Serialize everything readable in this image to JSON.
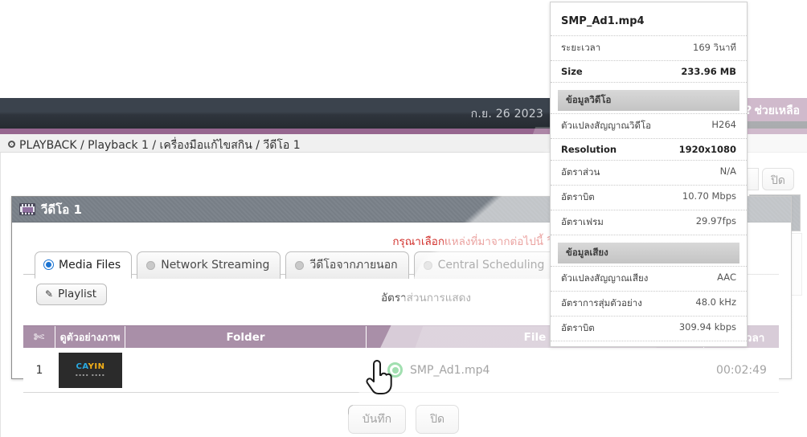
{
  "topbar": {
    "date": "ก.ย. 26 2023",
    "help_q": "?",
    "help_label": "ช่วยเหลือ"
  },
  "breadcrumb": {
    "text": "PLAYBACK / Playback 1 / เครื่องมือแก้ไขสกิน / วีดีโอ 1"
  },
  "right_tools": {
    "close_label": "ปิด",
    "expand_icon": "fullscreen-icon",
    "sound_icon": "speaker-icon"
  },
  "dialog": {
    "title": "วีดีโอ 1",
    "title_icon": "film-icon",
    "error_message": "กรุณาเลือกแหล่งที่มาจากต่อไปนี้ วีดีโอ",
    "tabs": [
      {
        "label": "Media Files",
        "selected": true
      },
      {
        "label": "Network Streaming",
        "selected": false
      },
      {
        "label": "วีดีโอจากภายนอก",
        "selected": false
      },
      {
        "label": "Central Scheduling",
        "selected": false
      }
    ],
    "playlist_button": "Playlist",
    "playlist_icon": "pencil-icon",
    "ratio_label": "อัตราส่วนการแสดง",
    "table": {
      "columns": [
        "✂",
        "ดูตัวอย่างภาพ",
        "Folder",
        "File",
        "ระยะเวลา"
      ],
      "rows": [
        {
          "num": "1",
          "thumb_logo_a": "CA",
          "thumb_logo_b": "YIN",
          "thumb_logo_sub": "",
          "folder": "",
          "file": "SMP_Ad1.mp4",
          "file_status_icon": "green-record-icon",
          "duration": "00:02:49"
        }
      ]
    },
    "buttons": {
      "save": "บันทึก",
      "close": "ปิด"
    }
  },
  "tooltip": {
    "filename": "SMP_Ad1.mp4",
    "basic": [
      {
        "key": "ระยะเวลา",
        "value": "169 วินาที",
        "bold": false
      },
      {
        "key": "Size",
        "value": "233.96 MB",
        "bold": true
      }
    ],
    "video_section": "ข้อมูลวิดีโอ",
    "video": [
      {
        "key": "ตัวแปลงสัญญาณวิดีโอ",
        "value": "H264",
        "bold": false
      },
      {
        "key": "Resolution",
        "value": "1920x1080",
        "bold": true
      },
      {
        "key": "อัตราส่วน",
        "value": "N/A",
        "bold": false
      },
      {
        "key": "อัตราบิต",
        "value": "10.70 Mbps",
        "bold": false
      },
      {
        "key": "อัตราเฟรม",
        "value": "29.97fps",
        "bold": false
      }
    ],
    "audio_section": "ข้อมูลเสียง",
    "audio": [
      {
        "key": "ตัวแปลงสัญญาณเสียง",
        "value": "AAC",
        "bold": false
      },
      {
        "key": "อัตราการสุ่มตัวอย่าง",
        "value": "48.0 kHz",
        "bold": false
      },
      {
        "key": "อัตราบิต",
        "value": "309.94 kbps",
        "bold": false
      }
    ]
  },
  "colors": {
    "accent_purple": "#96668f",
    "table_header": "#a98fa8",
    "dark_bar": "#3b434d",
    "error_red": "#d2322d",
    "status_green": "#2fb84f"
  }
}
